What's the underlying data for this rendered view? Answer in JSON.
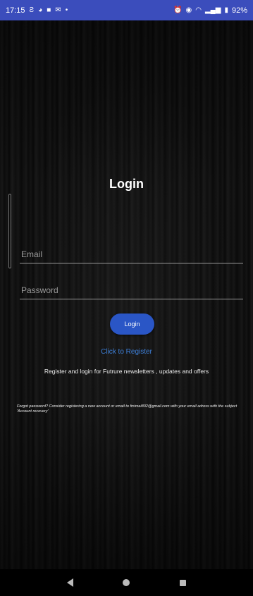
{
  "status_bar": {
    "time": "17:15",
    "left_icons": [
      "sim-icon",
      "messenger-icon",
      "facebook-icon",
      "gmail-icon",
      "dot-icon"
    ],
    "right_icons": [
      "alarm-icon",
      "vibrate-icon",
      "wifi-icon",
      "signal-icon",
      "battery-icon"
    ],
    "battery": "92%"
  },
  "login": {
    "title": "Login",
    "email_placeholder": "Email",
    "password_placeholder": "Password",
    "login_button": "Login",
    "register_link": "Click to Register",
    "info_text": "Register and login for Futrure newsletters , updates and offers",
    "forgot_text": "Forgot password? Consider registering a new account or email to fmimai802@gmail.com with your email adress with the subject 'Account recovery'"
  },
  "nav": {
    "items": [
      "back-icon",
      "home-icon",
      "recents-icon"
    ]
  },
  "colors": {
    "status_bar": "#3b4dbc",
    "button": "#2a56c6",
    "link": "#3d7fd8"
  }
}
